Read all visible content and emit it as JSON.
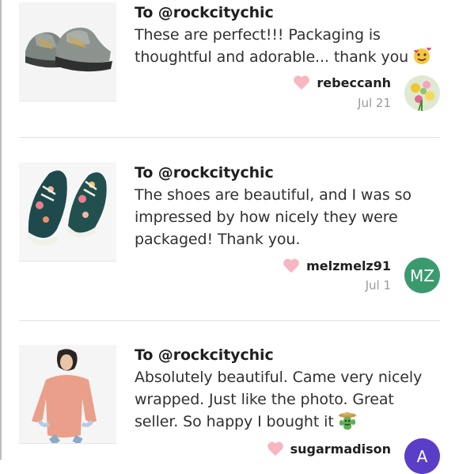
{
  "reviews": [
    {
      "to": "To @rockcitychic",
      "text": "These are perfect!!! Packaging is thoughtful and adorable... thank you",
      "username": "rebeccanh",
      "date": "Jul 21",
      "avatar_initials": "",
      "avatar_color": "#c9d9a0",
      "image": "hiking-shoes",
      "emoji": "smiling-face-with-hearts"
    },
    {
      "to": "To @rockcitychic",
      "text": "The shoes are beautiful, and I was so impressed by how nicely they were packaged! Thank you.",
      "username": "melzmelz91",
      "date": "Jul 1",
      "avatar_initials": "MZ",
      "avatar_color": "#3a9a6e",
      "image": "floral-sneakers"
    },
    {
      "to": "To @rockcitychic",
      "text": "Absolutely beautiful. Came very nicely wrapped. Just like the photo. Great seller. So happy I bought it",
      "username": "sugarmadison",
      "date": "",
      "avatar_initials": "A",
      "avatar_color": "#5a3ec8",
      "image": "pink-sweatshirt",
      "emoji": "cowboy-cactus"
    }
  ],
  "colors": {
    "heart": "#f7b6c2",
    "divider": "#e2e2e2",
    "date": "#9a9a9a"
  }
}
